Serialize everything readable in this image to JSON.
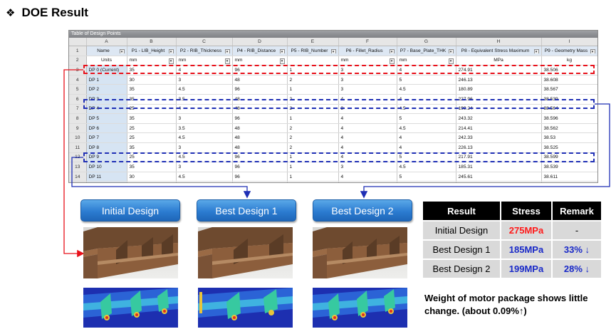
{
  "page": {
    "bullet": "❖",
    "title": "DOE Result"
  },
  "sheet": {
    "caption": "Table of Design Points",
    "col_letters": [
      "A",
      "B",
      "C",
      "D",
      "E",
      "F",
      "G",
      "H",
      "I"
    ],
    "headers": [
      "Name",
      "P1 - LIB_Height",
      "P2 - RIB_Thickness",
      "P4 - RIB_Distance",
      "P5 - RIB_Number",
      "P6 - Fillet_Radius",
      "P7 - Base_Plate_THK",
      "P8 - Equivalent Stress Maximum",
      "P9 - Geometry Mass"
    ],
    "units": [
      "Units",
      "mm",
      "mm",
      "mm",
      "",
      "mm",
      "mm",
      "MPa",
      "kg"
    ],
    "rows": [
      [
        "DP 0 (Current)",
        "35",
        "4",
        "96",
        "1",
        "3",
        "4",
        "274.91",
        "38.506"
      ],
      [
        "DP 1",
        "30",
        "3",
        "48",
        "2",
        "3",
        "5",
        "246.13",
        "38.608"
      ],
      [
        "DP 2",
        "35",
        "4.5",
        "96",
        "1",
        "3",
        "4.5",
        "180.89",
        "38.567"
      ],
      [
        "DP 3",
        "35",
        "3.5",
        "48",
        "2",
        "4",
        "4",
        "227.96",
        "38.539"
      ],
      [
        "DP 4",
        "25",
        "4",
        "48",
        "2",
        "3",
        "4.5",
        "199.24",
        "38.564"
      ],
      [
        "DP 5",
        "35",
        "3",
        "96",
        "1",
        "4",
        "5",
        "243.32",
        "38.596"
      ],
      [
        "DP 6",
        "25",
        "3.5",
        "48",
        "2",
        "4",
        "4.5",
        "214.41",
        "38.562"
      ],
      [
        "DP 7",
        "25",
        "4.5",
        "48",
        "2",
        "4",
        "4",
        "242.33",
        "38.53"
      ],
      [
        "DP 8",
        "35",
        "3",
        "48",
        "2",
        "4",
        "4",
        "226.13",
        "38.525"
      ],
      [
        "DP 9",
        "25",
        "4.5",
        "96",
        "1",
        "4",
        "5",
        "217.91",
        "38.599"
      ],
      [
        "DP 10",
        "35",
        "3",
        "96",
        "1",
        "3",
        "4.5",
        "185.31",
        "38.539"
      ],
      [
        "DP 11",
        "30",
        "4.5",
        "96",
        "1",
        "4",
        "5",
        "245.61",
        "38.611"
      ]
    ],
    "new_row_marker": "*"
  },
  "designs": {
    "initial": "Initial Design",
    "best1": "Best Design 1",
    "best2": "Best Design 2"
  },
  "results": {
    "headers": [
      "Result",
      "Stress",
      "Remark"
    ],
    "rows": [
      {
        "label": "Initial Design",
        "stress": "275MPa",
        "remark": "-",
        "stress_color": "#ff1a1a",
        "remark_color": "#000000"
      },
      {
        "label": "Best Design 1",
        "stress": "185MPa",
        "remark": "33% ↓",
        "stress_color": "#1a2ac8",
        "remark_color": "#1a2ac8"
      },
      {
        "label": "Best Design 2",
        "stress": "199MPa",
        "remark": "28% ↓",
        "stress_color": "#1a2ac8",
        "remark_color": "#1a2ac8"
      }
    ]
  },
  "note": "Weight of motor package shows little change. (about 0.09%↑)",
  "colors": {
    "highlight_red": "#e8101a",
    "highlight_blue": "#1f2fb5",
    "button_blue": "#2c7cd1",
    "part_brown": "#8c5e3c"
  }
}
